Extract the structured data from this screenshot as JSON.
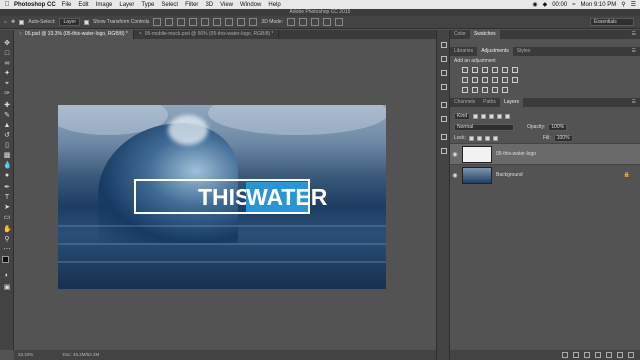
{
  "menubar": {
    "apple": "",
    "app_name": "Photoshop CC",
    "items": [
      "File",
      "Edit",
      "Image",
      "Layer",
      "Type",
      "Select",
      "Filter",
      "3D",
      "View",
      "Window",
      "Help"
    ],
    "battery": "00:00",
    "clock": "Mon 9:10 PM"
  },
  "title_bar": {
    "title": "Adobe Photoshop CC 2015"
  },
  "options_bar": {
    "auto_select_label": "Auto-Select:",
    "auto_select_value": "Layer",
    "show_transform_label": "Show Transform Controls",
    "mode_3d_label": "3D Mode:",
    "workspace": "Essentials"
  },
  "tabs": [
    {
      "label": "05.psd @ 33.3% (05-this-water-logo, RGB/8) *",
      "active": true
    },
    {
      "label": "05-mobile-mock.psd @ 50% (05-this-water-logo, RGB/8) *",
      "active": false
    }
  ],
  "artwork": {
    "word1": "THIS",
    "word2": "WATER",
    "accent": "#2a95d5"
  },
  "status": {
    "zoom": "33.33%",
    "doc": "Doc: 45.2M/52.2M"
  },
  "panel_top": {
    "tabs": [
      {
        "label": "Color",
        "active": false
      },
      {
        "label": "Swatches",
        "active": true
      }
    ]
  },
  "panel_mid": {
    "tabs": [
      {
        "label": "Libraries",
        "active": false
      },
      {
        "label": "Adjustments",
        "active": true
      },
      {
        "label": "Styles",
        "active": false
      }
    ],
    "add_adjustment": "Add an adjustment"
  },
  "panel_layers": {
    "tabs": [
      {
        "label": "Channels",
        "active": false
      },
      {
        "label": "Paths",
        "active": false
      },
      {
        "label": "Layers",
        "active": true
      }
    ],
    "filter_kind": "Kind",
    "blend_mode": "Normal",
    "opacity_label": "Opacity:",
    "opacity_value": "100%",
    "lock_label": "Lock:",
    "fill_label": "Fill:",
    "fill_value": "100%",
    "layers": [
      {
        "name": "05-this-water-logo",
        "selected": true
      },
      {
        "name": "Background",
        "selected": false
      }
    ]
  }
}
